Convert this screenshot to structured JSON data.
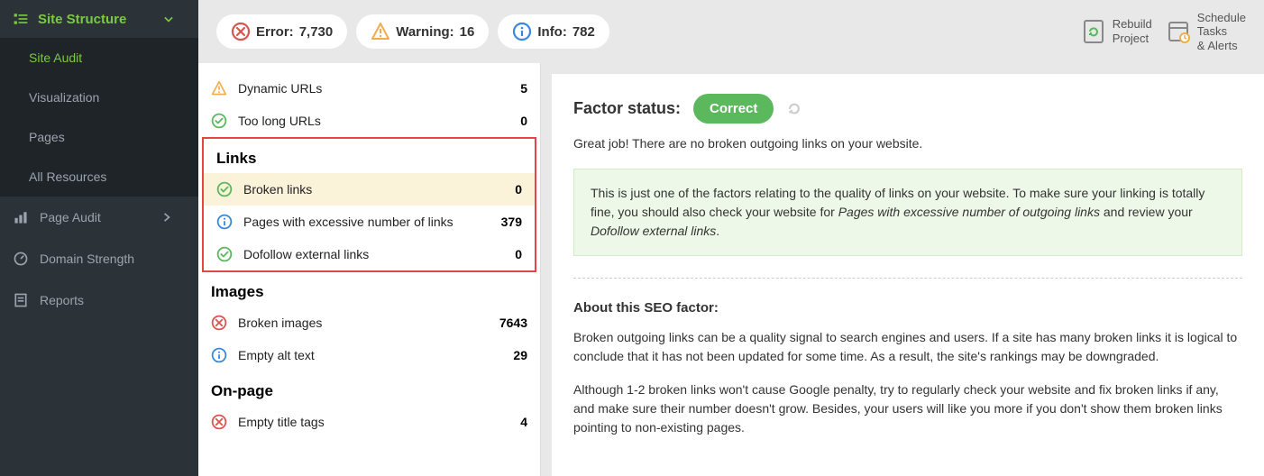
{
  "sidebar": {
    "header": "Site Structure",
    "subs": [
      {
        "label": "Site Audit",
        "active": true
      },
      {
        "label": "Visualization",
        "active": false
      },
      {
        "label": "Pages",
        "active": false
      },
      {
        "label": "All Resources",
        "active": false
      }
    ],
    "sections": [
      {
        "label": "Page Audit",
        "icon": "bars"
      },
      {
        "label": "Domain Strength",
        "icon": "gauge"
      },
      {
        "label": "Reports",
        "icon": "clipboard"
      }
    ]
  },
  "topbar": {
    "error_label": "Error:",
    "error_count": "7,730",
    "warning_label": "Warning:",
    "warning_count": "16",
    "info_label": "Info:",
    "info_count": "782",
    "rebuild": "Rebuild\nProject",
    "schedule": "Schedule\nTasks\n& Alerts"
  },
  "factors": {
    "pre_rows": [
      {
        "icon": "warn",
        "name": "Dynamic URLs",
        "value": "5"
      },
      {
        "icon": "ok",
        "name": "Too long URLs",
        "value": "0"
      }
    ],
    "links_title": "Links",
    "links_rows": [
      {
        "icon": "ok",
        "name": "Broken links",
        "value": "0",
        "selected": true
      },
      {
        "icon": "info",
        "name": "Pages with excessive number of links",
        "value": "379"
      },
      {
        "icon": "ok",
        "name": "Dofollow external links",
        "value": "0"
      }
    ],
    "images_title": "Images",
    "images_rows": [
      {
        "icon": "error",
        "name": "Broken images",
        "value": "7643"
      },
      {
        "icon": "info",
        "name": "Empty alt text",
        "value": "29"
      }
    ],
    "onpage_title": "On-page",
    "onpage_rows": [
      {
        "icon": "error",
        "name": "Empty title tags",
        "value": "4"
      }
    ]
  },
  "detail": {
    "status_label": "Factor status:",
    "status_value": "Correct",
    "status_text": "Great job! There are no broken outgoing links on your website.",
    "tip_pre": "This is just one of the factors relating to the quality of links on your website. To make sure your linking is totally fine, you should also check your website for ",
    "tip_em1": "Pages with excessive number of outgoing links",
    "tip_mid": " and review your ",
    "tip_em2": "Dofollow external links",
    "tip_post": ".",
    "about_title": "About this SEO factor:",
    "about_p1": "Broken outgoing links can be a quality signal to search engines and users. If a site has many broken links it is logical to conclude that it has not been updated for some time. As a result, the site's rankings may be downgraded.",
    "about_p2": "Although 1-2 broken links won't cause Google penalty, try to regularly check your website and fix broken links if any, and make sure their number doesn't grow. Besides, your users will like you more if you don't show them broken links pointing to non-existing pages."
  }
}
